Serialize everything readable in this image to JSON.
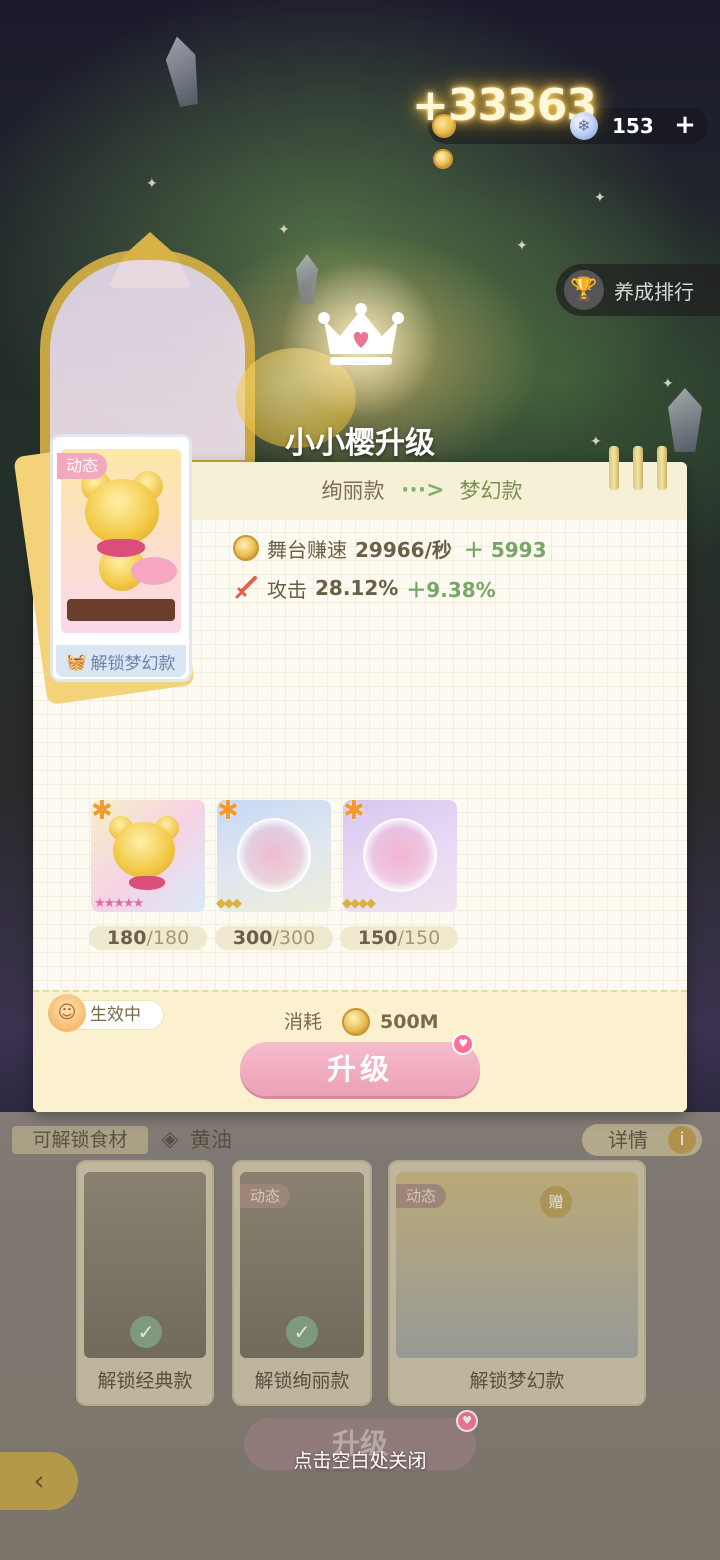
{
  "hud": {
    "gain_popup": "+33363",
    "gem_count": "153",
    "plus_symbol": "+",
    "ranking_label": "养成排行"
  },
  "dialog": {
    "title": "小小樱升级",
    "version_from": "绚丽款",
    "version_to": "梦幻款",
    "arrow": "···>",
    "stats": [
      {
        "label": "舞台赚速",
        "value": "29966/秒",
        "bonus": "＋ 5993"
      },
      {
        "label": "攻击",
        "value": "28.12%",
        "bonus": "＋9.38%"
      }
    ],
    "card": {
      "badge": "动态",
      "unlock_label": "解锁梦幻款"
    },
    "slots": [
      {
        "current": "180",
        "max": "/180",
        "stars": "★★★★★",
        "star_color": "#e86aa3"
      },
      {
        "current": "300",
        "max": "/300",
        "stars": "◆◆◆",
        "star_color": "#d8b340"
      },
      {
        "current": "150",
        "max": "/150",
        "stars": "◆◆◆◆",
        "star_color": "#d8b340"
      }
    ],
    "effect_label": "生效中",
    "cost_label": "消耗",
    "cost_value": "500M",
    "upgrade_label": "升级"
  },
  "background_ui": {
    "unlock_ingredients": "可解锁食材",
    "ingredient": "黄油",
    "details": "详情",
    "info_icon": "i",
    "cards": [
      {
        "label": "解锁经典款"
      },
      {
        "label": "解锁绚丽款",
        "badge": "动态"
      },
      {
        "label": "解锁梦幻款",
        "badge": "动态",
        "gift": "赠"
      }
    ],
    "upgrade_label": "升级",
    "back_icon": "‹"
  },
  "close_hint": "点击空白处关闭",
  "colors": {
    "accent_pink": "#eba1b6",
    "bonus_green": "#76a863",
    "panel_bg": "#fdfbf1"
  }
}
